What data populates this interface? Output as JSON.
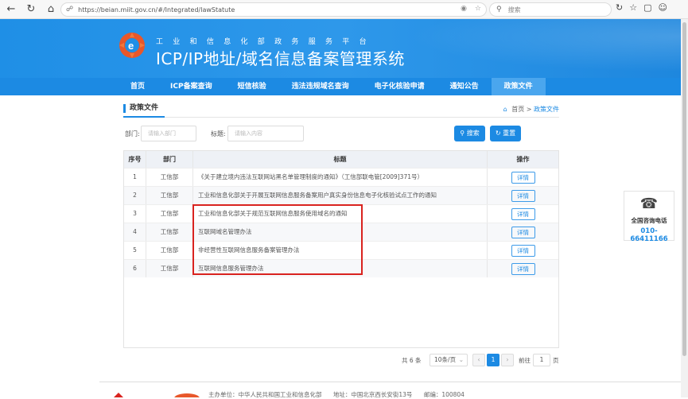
{
  "browser": {
    "url": "https://beian.miit.gov.cn/#/Integrated/lawStatute",
    "search_placeholder": "搜索"
  },
  "header": {
    "subtitle": "工业和信息化部政务服务平台",
    "title": "ICP/IP地址/域名信息备案管理系统"
  },
  "nav": {
    "items": [
      {
        "label": "首页"
      },
      {
        "label": "ICP备案查询"
      },
      {
        "label": "短信核验"
      },
      {
        "label": "违法违规域名查询"
      },
      {
        "label": "电子化核验申请"
      },
      {
        "label": "通知公告"
      },
      {
        "label": "政策文件"
      }
    ],
    "active": "政策文件"
  },
  "section": {
    "title": "政策文件",
    "breadcrumb_home": "首页",
    "breadcrumb_sep": ">",
    "breadcrumb_current": "政策文件"
  },
  "filters": {
    "dept_label": "部门:",
    "dept_placeholder": "请输入部门",
    "title_label": "标题:",
    "title_placeholder": "请输入内容",
    "search_btn": "搜索",
    "reset_btn": "重置"
  },
  "table": {
    "headers": {
      "no": "序号",
      "dept": "部门",
      "title": "标题",
      "op": "操作"
    },
    "detail_label": "详情",
    "rows": [
      {
        "no": "1",
        "dept": "工信部",
        "title": "《关于建立境内违法互联网站黑名单管理制度的通知》（工信部联电管[2009]371号）"
      },
      {
        "no": "2",
        "dept": "工信部",
        "title": "工业和信息化部关于开展互联网信息服务备案用户真实身份信息电子化核验试点工作的通知"
      },
      {
        "no": "3",
        "dept": "工信部",
        "title": "工业和信息化部关于规范互联网信息服务使用域名的通知"
      },
      {
        "no": "4",
        "dept": "工信部",
        "title": "互联网域名管理办法"
      },
      {
        "no": "5",
        "dept": "工信部",
        "title": "非经营性互联网信息服务备案管理办法"
      },
      {
        "no": "6",
        "dept": "工信部",
        "title": "互联网信息服务管理办法"
      }
    ]
  },
  "pager": {
    "total": "共 6 条",
    "page_size": "10条/页",
    "current": "1",
    "goto_label": "前往",
    "goto_value": "1",
    "goto_suffix": "页"
  },
  "hotline": {
    "label": "全国咨询电话",
    "number": "010-66411166"
  },
  "footer": {
    "host": "主办单位：中华人民共和国工业和信息化部",
    "address": "地址：中国北京西长安街13号",
    "postcode": "邮编：100804"
  }
}
